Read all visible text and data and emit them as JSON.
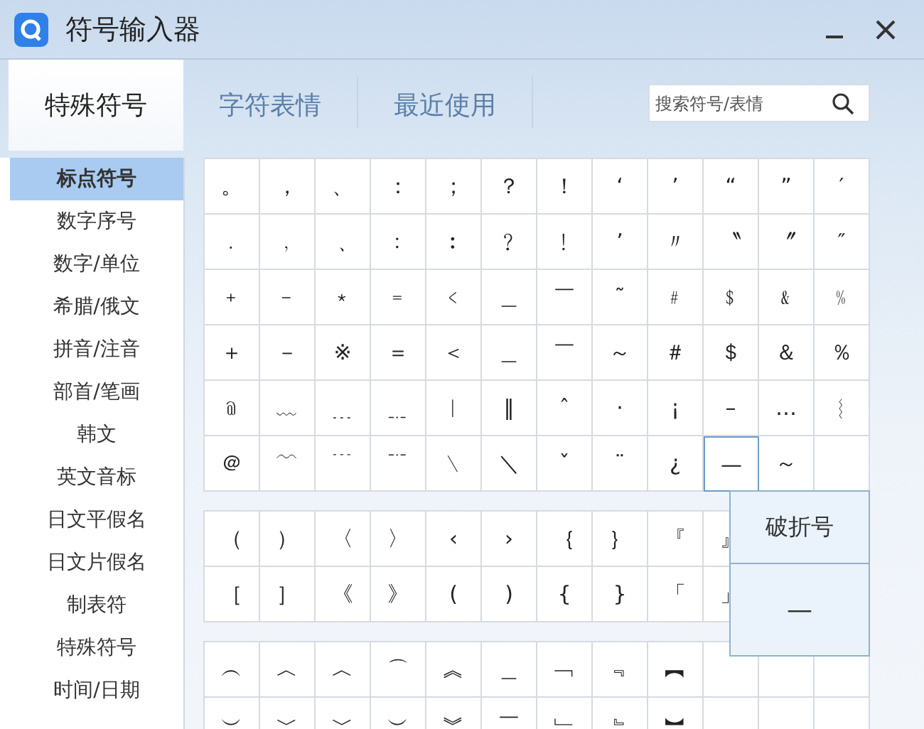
{
  "window": {
    "title": "符号输入器"
  },
  "tabs": [
    {
      "label": "特殊符号",
      "selected": true
    },
    {
      "label": "字符表情",
      "selected": false
    },
    {
      "label": "最近使用",
      "selected": false
    }
  ],
  "search": {
    "placeholder": "搜索符号/表情"
  },
  "categories": [
    {
      "label": "标点符号",
      "selected": true
    },
    {
      "label": "数字序号",
      "selected": false
    },
    {
      "label": "数字/单位",
      "selected": false
    },
    {
      "label": "希腊/俄文",
      "selected": false
    },
    {
      "label": "拼音/注音",
      "selected": false
    },
    {
      "label": "部首/笔画",
      "selected": false
    },
    {
      "label": "韩文",
      "selected": false
    },
    {
      "label": "英文音标",
      "selected": false
    },
    {
      "label": "日文平假名",
      "selected": false
    },
    {
      "label": "日文片假名",
      "selected": false
    },
    {
      "label": "制表符",
      "selected": false
    },
    {
      "label": "特殊符号",
      "selected": false
    },
    {
      "label": "时间/日期",
      "selected": false
    }
  ],
  "groups": [
    {
      "rows": [
        [
          {
            "char": "。",
            "hovered": false
          },
          {
            "char": "，",
            "hovered": false
          },
          {
            "char": "、",
            "hovered": false
          },
          {
            "char": "：",
            "hovered": false
          },
          {
            "char": "；",
            "hovered": false
          },
          {
            "char": "？",
            "hovered": false
          },
          {
            "char": "！",
            "hovered": false
          },
          {
            "char": "‘",
            "hovered": false
          },
          {
            "char": "’",
            "hovered": false
          },
          {
            "char": "“",
            "hovered": false
          },
          {
            "char": "”",
            "hovered": false
          },
          {
            "char": "′",
            "hovered": false
          }
        ],
        [
          {
            "char": "﹒",
            "hovered": false
          },
          {
            "char": "﹐",
            "hovered": false
          },
          {
            "char": "﹑",
            "hovered": false
          },
          {
            "char": "﹕",
            "hovered": false
          },
          {
            "char": "︰",
            "hovered": false
          },
          {
            "char": "﹖",
            "hovered": false
          },
          {
            "char": "﹗",
            "hovered": false
          },
          {
            "char": "’",
            "hovered": false
          },
          {
            "char": "〃",
            "hovered": false
          },
          {
            "char": "〝",
            "hovered": false
          },
          {
            "char": "〞",
            "hovered": false
          },
          {
            "char": "″",
            "hovered": false
          }
        ],
        [
          {
            "char": "﹢",
            "hovered": false
          },
          {
            "char": "﹣",
            "hovered": false
          },
          {
            "char": "﹡",
            "hovered": false
          },
          {
            "char": "﹦",
            "hovered": false
          },
          {
            "char": "﹤",
            "hovered": false
          },
          {
            "char": "＿",
            "hovered": false
          },
          {
            "char": "￣",
            "hovered": false
          },
          {
            "char": "˜",
            "hovered": false
          },
          {
            "char": "﹟",
            "hovered": false
          },
          {
            "char": "﹩",
            "hovered": false
          },
          {
            "char": "﹠",
            "hovered": false
          },
          {
            "char": "﹪",
            "hovered": false
          }
        ],
        [
          {
            "char": "＋",
            "hovered": false
          },
          {
            "char": "－",
            "hovered": false
          },
          {
            "char": "※",
            "hovered": false
          },
          {
            "char": "＝",
            "hovered": false
          },
          {
            "char": "＜",
            "hovered": false
          },
          {
            "char": "＿",
            "hovered": false
          },
          {
            "char": "￣",
            "hovered": false
          },
          {
            "char": "～",
            "hovered": false
          },
          {
            "char": "＃",
            "hovered": false
          },
          {
            "char": "＄",
            "hovered": false
          },
          {
            "char": "＆",
            "hovered": false
          },
          {
            "char": "％",
            "hovered": false
          }
        ],
        [
          {
            "char": "﹫",
            "hovered": false
          },
          {
            "char": "﹏",
            "hovered": false
          },
          {
            "char": "﹍",
            "hovered": false
          },
          {
            "char": "﹎",
            "hovered": false
          },
          {
            "char": "︱",
            "hovered": false
          },
          {
            "char": "‖",
            "hovered": false
          },
          {
            "char": "ˆ",
            "hovered": false
          },
          {
            "char": "·",
            "hovered": false
          },
          {
            "char": "¡",
            "hovered": false
          },
          {
            "char": "–",
            "hovered": false
          },
          {
            "char": "…",
            "hovered": false
          },
          {
            "char": "︴",
            "hovered": false
          }
        ],
        [
          {
            "char": "＠",
            "hovered": false
          },
          {
            "char": "﹋",
            "hovered": false
          },
          {
            "char": "﹉",
            "hovered": false
          },
          {
            "char": "﹊",
            "hovered": false
          },
          {
            "char": "﹨",
            "hovered": false
          },
          {
            "char": "＼",
            "hovered": false
          },
          {
            "char": "ˇ",
            "hovered": false
          },
          {
            "char": "¨",
            "hovered": false
          },
          {
            "char": "¿",
            "hovered": false
          },
          {
            "char": "—",
            "hovered": true
          },
          {
            "char": "～",
            "hovered": false
          }
        ]
      ]
    },
    {
      "rows": [
        [
          {
            "char": "（",
            "hovered": false
          },
          {
            "char": "）",
            "hovered": false
          },
          {
            "char": "〈",
            "hovered": false
          },
          {
            "char": "〉",
            "hovered": false
          },
          {
            "char": "‹",
            "hovered": false
          },
          {
            "char": "›",
            "hovered": false
          },
          {
            "char": "｛",
            "hovered": false
          },
          {
            "char": "｝",
            "hovered": false
          },
          {
            "char": "『",
            "hovered": false
          },
          {
            "char": "』",
            "hovered": false
          }
        ],
        [
          {
            "char": "［",
            "hovered": false
          },
          {
            "char": "］",
            "hovered": false
          },
          {
            "char": "《",
            "hovered": false
          },
          {
            "char": "》",
            "hovered": false
          },
          {
            "char": "(",
            "hovered": false
          },
          {
            "char": ")",
            "hovered": false
          },
          {
            "char": "{",
            "hovered": false
          },
          {
            "char": "}",
            "hovered": false
          },
          {
            "char": "「",
            "hovered": false
          },
          {
            "char": "」",
            "hovered": false
          }
        ]
      ]
    },
    {
      "rows": [
        [
          {
            "char": "︵",
            "hovered": false
          },
          {
            "char": "︿",
            "hovered": false
          },
          {
            "char": "︿",
            "hovered": false
          },
          {
            "char": "⌒",
            "hovered": false
          },
          {
            "char": "︽",
            "hovered": false
          },
          {
            "char": "＿",
            "hovered": false
          },
          {
            "char": "﹁",
            "hovered": false
          },
          {
            "char": "﹃",
            "hovered": false
          },
          {
            "char": "︻",
            "hovered": false
          }
        ],
        [
          {
            "char": "︶",
            "hovered": false
          },
          {
            "char": "﹀",
            "hovered": false
          },
          {
            "char": "﹀",
            "hovered": false
          },
          {
            "char": "︶",
            "hovered": false
          },
          {
            "char": "︾",
            "hovered": false
          },
          {
            "char": "￣",
            "hovered": false
          },
          {
            "char": "﹂",
            "hovered": false
          },
          {
            "char": "﹄",
            "hovered": false
          },
          {
            "char": "︼",
            "hovered": false
          }
        ]
      ]
    }
  ],
  "tooltip": {
    "name": "破折号",
    "symbol": "—"
  }
}
